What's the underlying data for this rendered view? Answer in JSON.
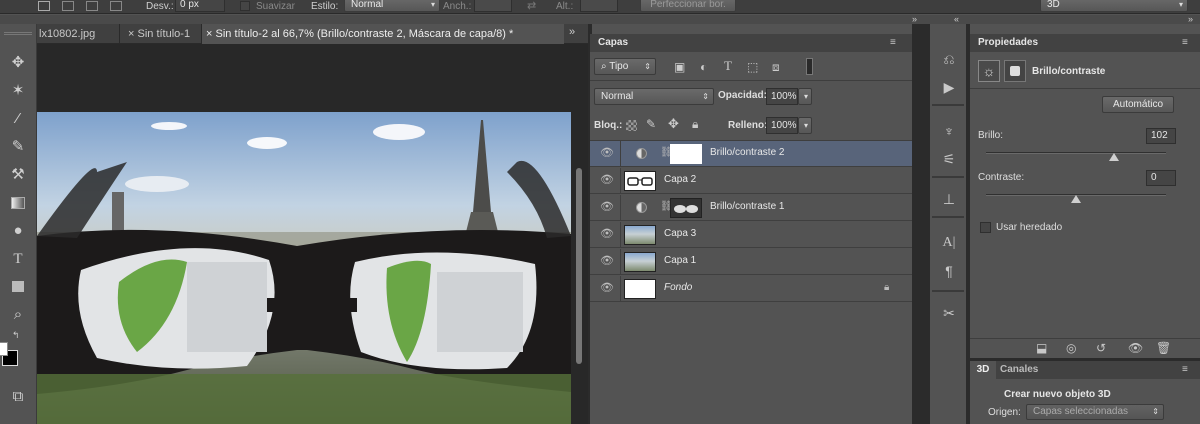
{
  "options_bar": {
    "desv_label": "Desv.:",
    "desv_value": "0 px",
    "suavizar_label": "Suavizar",
    "estilo_label": "Estilo:",
    "estilo_value": "Normal",
    "anch_label": "Anch.:",
    "alt_label": "Alt.:",
    "refine_button": "Perfeccionar bor.",
    "workspace_value": "3D"
  },
  "doc_tabs": [
    {
      "label": "lx10802.jpg"
    },
    {
      "label": "Sin título-1"
    },
    {
      "label": "Sin título-2 al 66,7% (Brillo/contraste 2, Máscara de capa/8) *"
    }
  ],
  "layers_panel": {
    "title": "Capas",
    "filter_kind": "Tipo",
    "blend_mode": "Normal",
    "opacity_label": "Opacidad:",
    "opacity_value": "100%",
    "lock_label": "Bloq.:",
    "fill_label": "Relleno:",
    "fill_value": "100%",
    "layers": [
      {
        "name": "Brillo/contraste 2"
      },
      {
        "name": "Capa 2"
      },
      {
        "name": "Brillo/contraste 1"
      },
      {
        "name": "Capa 3"
      },
      {
        "name": "Capa 1"
      },
      {
        "name": "Fondo"
      }
    ]
  },
  "properties_panel": {
    "title": "Propiedades",
    "adjustment_name": "Brillo/contraste",
    "auto_button": "Automático",
    "brightness_label": "Brillo:",
    "brightness_value": "102",
    "contrast_label": "Contraste:",
    "contrast_value": "0",
    "legacy_label": "Usar heredado",
    "brightness_slider_fraction": 0.71,
    "contrast_slider_fraction": 0.5
  },
  "bottom_panel": {
    "tab_3d": "3D",
    "tab_channels": "Canales",
    "create_label": "Crear nuevo objeto 3D",
    "origin_label": "Origen:",
    "origin_value": "Capas seleccionadas"
  },
  "icons": [
    "move-icon",
    "magic-wand-icon",
    "eyedropper-icon",
    "brush-icon",
    "stamp-icon",
    "gradient-icon",
    "blur-icon",
    "type-icon",
    "rectangle-icon",
    "zoom-icon",
    "eye-icon",
    "lock-icon",
    "link-icon",
    "trash-icon"
  ]
}
